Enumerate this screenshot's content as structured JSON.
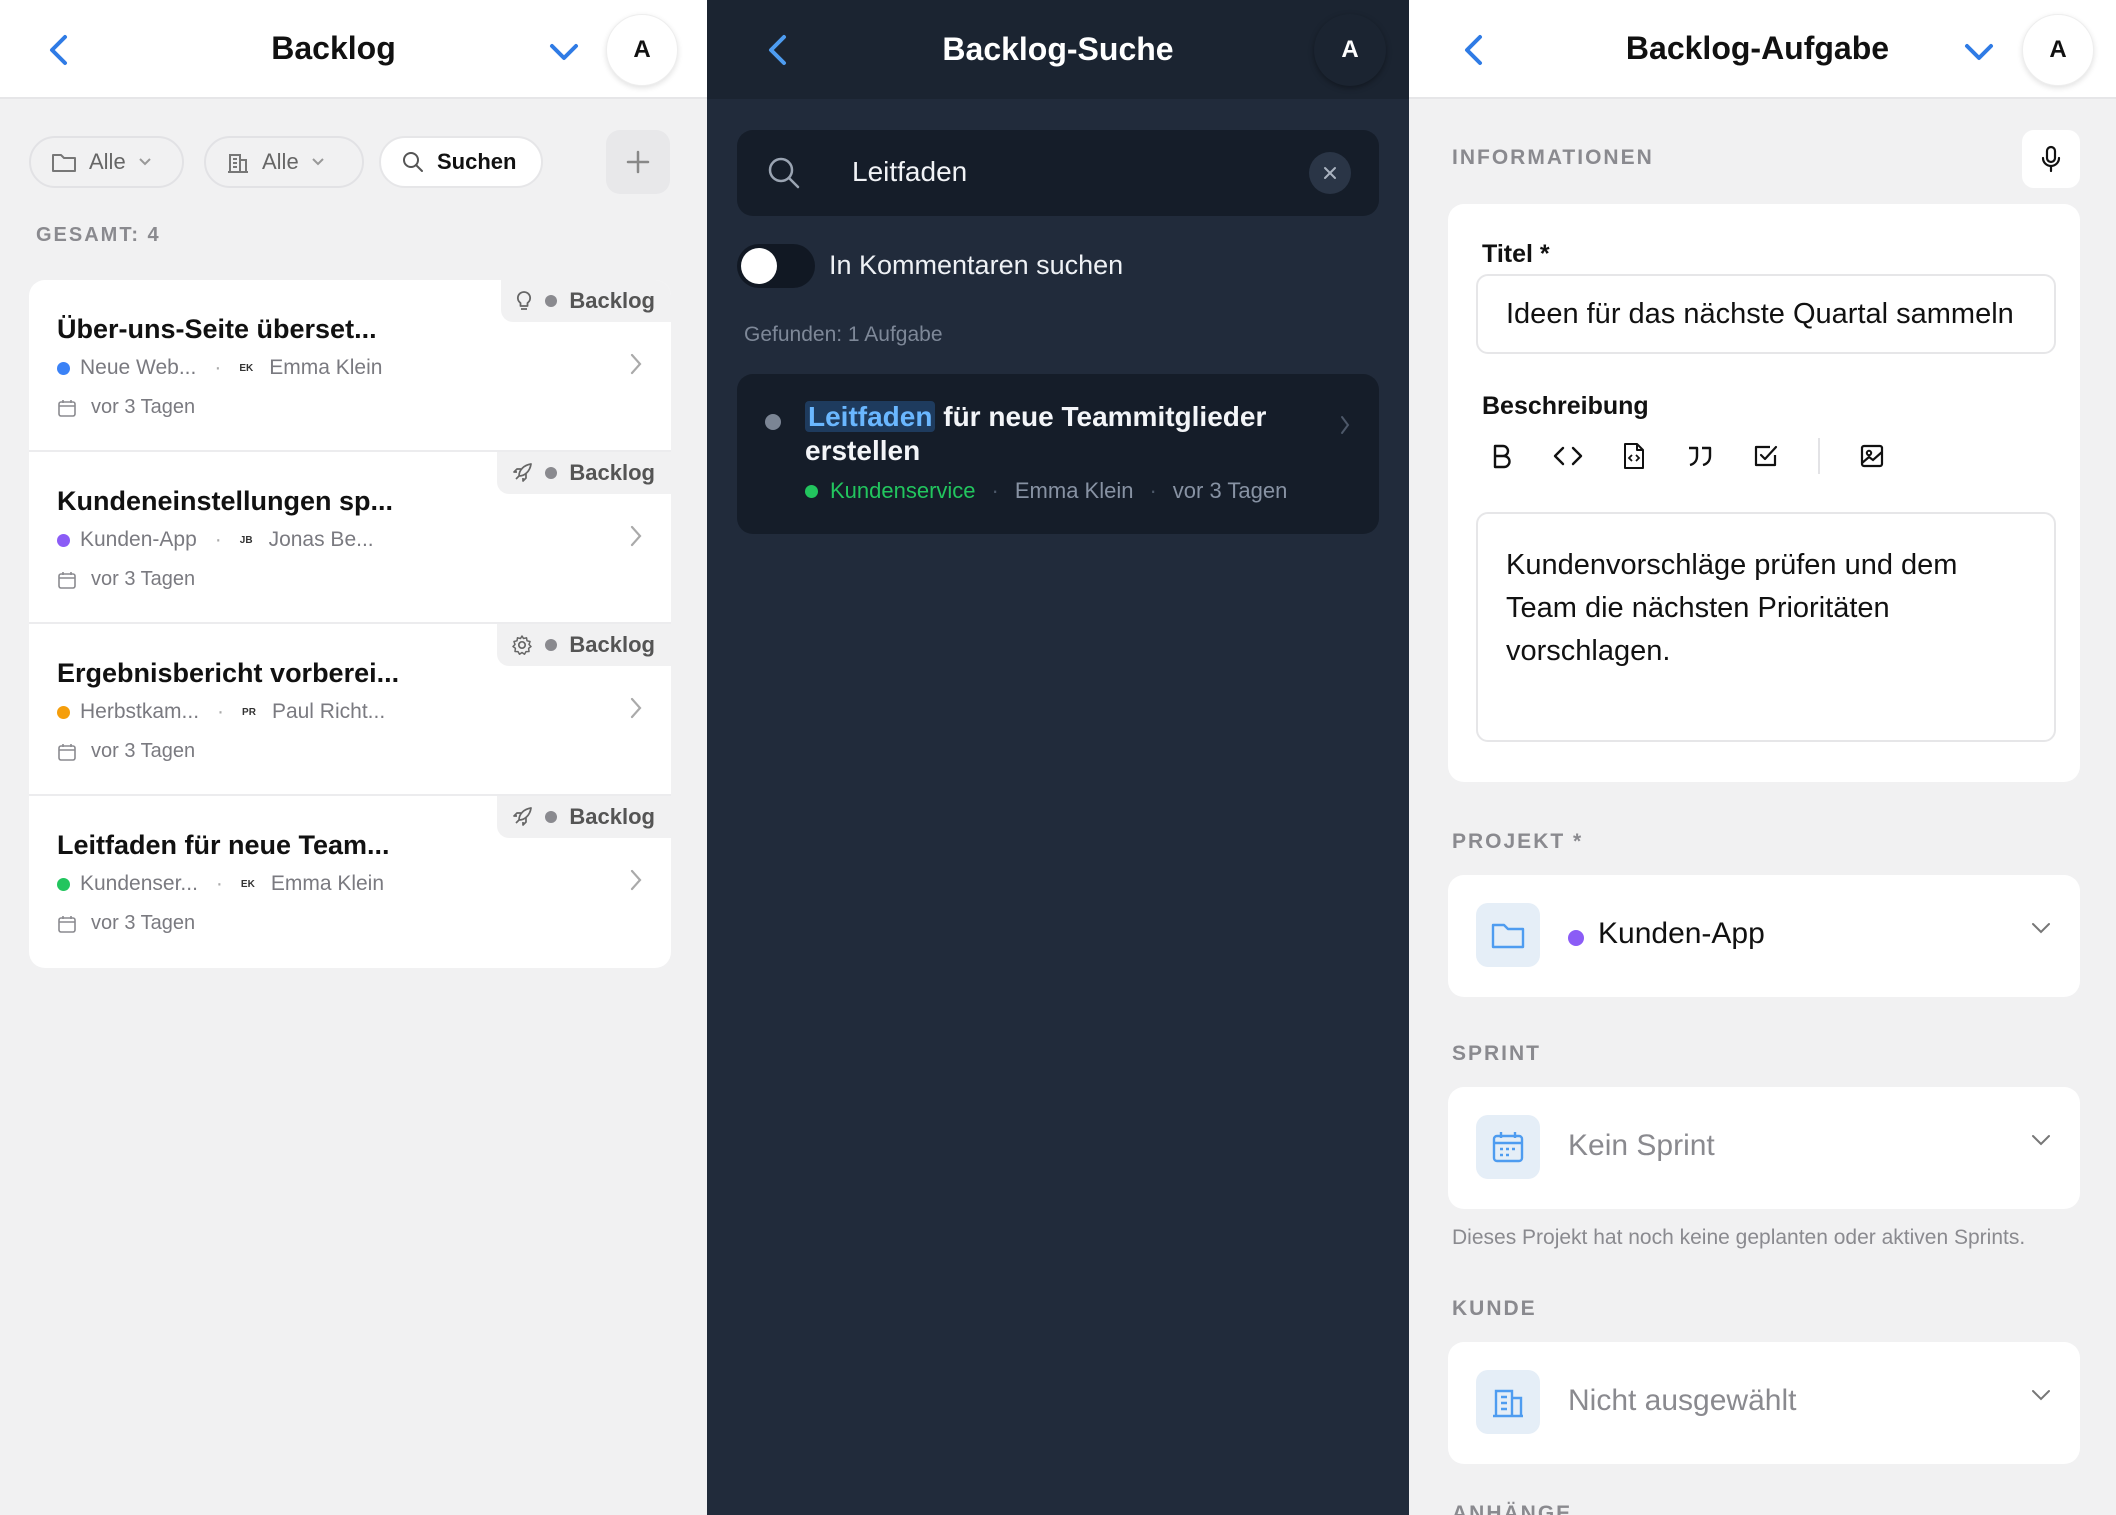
{
  "panel_left": {
    "header": {
      "title": "Backlog",
      "avatar": "A"
    },
    "filters": {
      "project_label": "Alle",
      "client_label": "Alle",
      "search_label": "Suchen"
    },
    "total_label": "GESAMT: 4",
    "items": [
      {
        "status_icon": "lightbulb-icon",
        "status": "Backlog",
        "title": "Über-uns-Seite überset...",
        "project": "Neue Web...",
        "project_color": "#3b82f6",
        "assignee_initials": "EK",
        "assignee": "Emma Klein",
        "date": "vor 3 Tagen"
      },
      {
        "status_icon": "rocket-icon",
        "status": "Backlog",
        "title": "Kundeneinstellungen sp...",
        "project": "Kunden-App",
        "project_color": "#8b5cf6",
        "assignee_initials": "JB",
        "assignee": "Jonas Be...",
        "date": "vor 3 Tagen"
      },
      {
        "status_icon": "gear-icon",
        "status": "Backlog",
        "title": "Ergebnisbericht vorberei...",
        "project": "Herbstkam...",
        "project_color": "#f59e0b",
        "assignee_initials": "PR",
        "assignee": "Paul Richt...",
        "date": "vor 3 Tagen"
      },
      {
        "status_icon": "rocket-icon",
        "status": "Backlog",
        "title": "Leitfaden für neue Team...",
        "project": "Kundenser...",
        "project_color": "#22c55e",
        "assignee_initials": "EK",
        "assignee": "Emma Klein",
        "date": "vor 3 Tagen"
      }
    ]
  },
  "panel_middle": {
    "header": {
      "title": "Backlog-Suche",
      "avatar": "A"
    },
    "search": {
      "value": "Leitfaden"
    },
    "toggle": {
      "label": "In Kommentaren suchen",
      "on": false
    },
    "found_label": "Gefunden: 1 Aufgabe",
    "result": {
      "highlight": "Leitfaden",
      "title_rest": " für neue Teammitglieder erstellen",
      "project": "Kundenservice",
      "project_color": "#22c55e",
      "assignee": "Emma Klein",
      "date": "vor 3 Tagen"
    }
  },
  "panel_right": {
    "header": {
      "title": "Backlog-Aufgabe",
      "avatar": "A"
    },
    "section_info": "INFORMATIONEN",
    "title_label": "Titel *",
    "title_value": "Ideen für das nächste Quartal sammeln",
    "description_label": "Beschreibung",
    "description_value": "Kundenvorschläge prüfen und dem Team die nächsten Prioritäten vorschlagen.",
    "section_project": "PROJEKT *",
    "project_value": "Kunden-App",
    "project_color": "#8b5cf6",
    "section_sprint": "SPRINT",
    "sprint_value": "Kein Sprint",
    "sprint_hint": "Dieses Projekt hat noch keine geplanten oder aktiven Sprints.",
    "section_client": "KUNDE",
    "client_value": "Nicht ausgewählt",
    "section_next": "ANHÄNGE"
  },
  "colors": {
    "accent": "#2f7be5",
    "dark_bg": "#212b3b",
    "dark_card": "#151d29"
  }
}
